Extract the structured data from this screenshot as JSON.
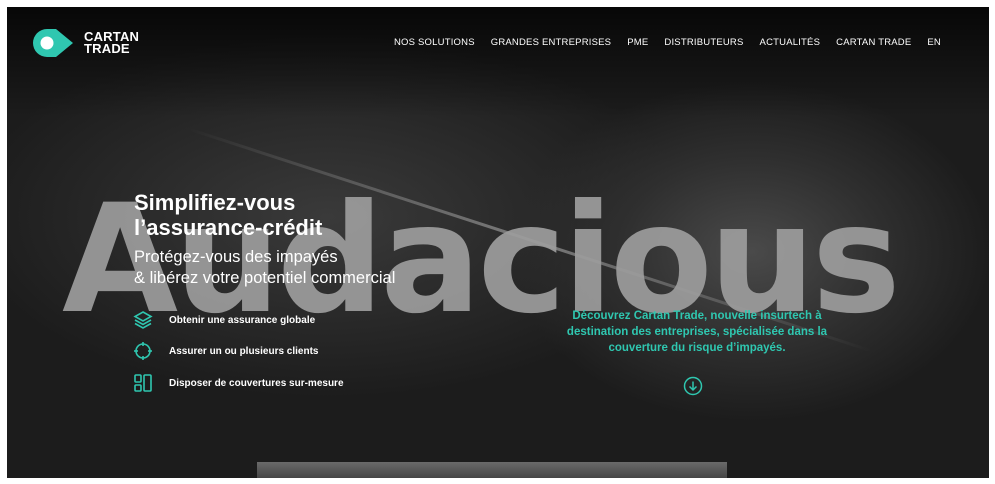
{
  "brand": {
    "name_line1": "CARTAN",
    "name_line2": "TRADE"
  },
  "colors": {
    "accent": "#2fc7b0",
    "text": "#ffffff",
    "watermark": "#9d9d9d"
  },
  "nav": {
    "items": [
      {
        "label": "NOS SOLUTIONS"
      },
      {
        "label": "GRANDES ENTREPRISES"
      },
      {
        "label": "PME"
      },
      {
        "label": "DISTRIBUTEURS"
      },
      {
        "label": "ACTUALITÉS"
      },
      {
        "label": "CARTAN TRADE"
      },
      {
        "label": "EN"
      }
    ]
  },
  "hero": {
    "watermark": "Audacious",
    "headline_line1": "Simplifiez-vous",
    "headline_line2": "l’assurance-crédit",
    "sub_line1": "Protégez-vous des impayés",
    "sub_line2": "& libérez votre potentiel commercial",
    "features": [
      {
        "icon": "layers-icon",
        "label": "Obtenir une assurance globale"
      },
      {
        "icon": "target-icon",
        "label": "Assurer un ou plusieurs clients"
      },
      {
        "icon": "grid-blocks-icon",
        "label": "Disposer de couvertures sur-mesure"
      }
    ],
    "teaser_line1": "Découvrez Cartan Trade, nouvelle insurtech à",
    "teaser_line2": "destination des entreprises, spécialisée dans la",
    "teaser_line3": "couverture du risque d’impayés.",
    "scroll_icon": "arrow-down-circle-icon"
  }
}
